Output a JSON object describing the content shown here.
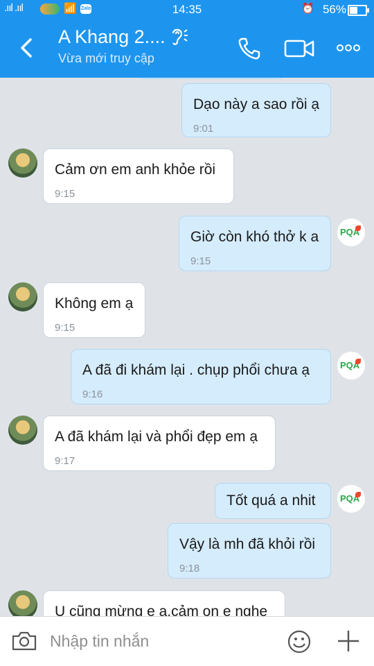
{
  "status_bar": {
    "signal": ".ııl .ııl",
    "time": "14:35",
    "battery_percent": "56%",
    "battery_level": 0.56,
    "zalo_mini": "Zalo"
  },
  "header": {
    "title": "A Khang 2....",
    "status": "Vừa mới truy cập"
  },
  "messages": [
    {
      "dir": "out",
      "text": "Dạo này a sao rồi ạ",
      "time": "9:01"
    },
    {
      "dir": "in",
      "text": "Cảm ơn em anh khỏe rồi",
      "time": "9:15"
    },
    {
      "dir": "out",
      "text": "Giờ còn khó thở k a",
      "time": "9:15"
    },
    {
      "dir": "in",
      "text": "Không em ạ",
      "time": "9:15"
    },
    {
      "dir": "out",
      "text": "A đã đi khám lại . chụp phổi chưa ạ",
      "time": "9:16"
    },
    {
      "dir": "in",
      "text": "A đã khám lại và phổi đẹp em ạ",
      "time": "9:17"
    },
    {
      "dir": "out",
      "text": "Tốt quá a nhit",
      "time": ""
    },
    {
      "dir": "out",
      "text": "Vậy là mh đã khỏi rồi",
      "time": "9:18"
    },
    {
      "dir": "in",
      "text": "U cũng mừng e ạ,cảm on e nghe",
      "time": ""
    }
  ],
  "pqa_logo": "PQA",
  "input": {
    "placeholder": "Nhập tin nhắn"
  },
  "colors": {
    "brand": "#1d95ef",
    "bubble_out": "#d5ecfc",
    "bubble_in": "#ffffff",
    "chat_bg": "#dfe3e8"
  }
}
